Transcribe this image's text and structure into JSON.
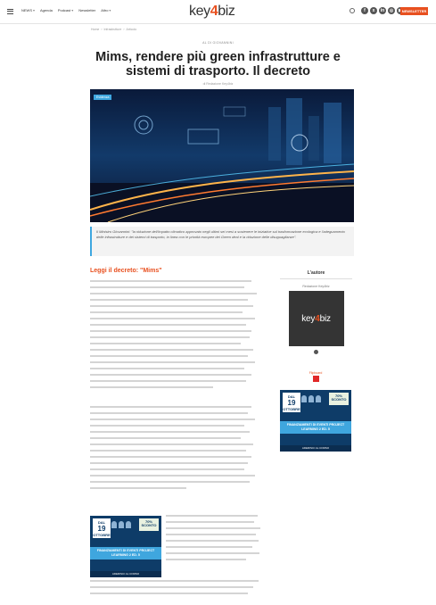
{
  "header": {
    "nav_items": [
      "NEWS",
      "Agenda",
      "Podcast",
      "Newsletter",
      "Altro"
    ],
    "logo_pre": "key",
    "logo_mark": "4",
    "logo_post": "biz",
    "newsletter_label": "NEWSLETTER",
    "social_icons": [
      "facebook-icon",
      "x-icon",
      "linkedin-icon",
      "instagram-icon",
      "youtube-icon"
    ],
    "brand_color": "#e8501f"
  },
  "breadcrumb": [
    "Home",
    "Infrastrutture",
    "Articolo"
  ],
  "article": {
    "category": "AL DI GIOVANNINI",
    "title": "Mims, rendere più green infrastrutture e sistemi di trasporto. Il decreto",
    "byline": "di Redazione Key4biz",
    "hero_tag": "Evidenza",
    "summary": "Il Ministro Giovannini: \"la riduzione dell'impatto climatico approvato negli ultimi sei mesi a sostenere le iniziative sul trasformazione ecologica e l'adeguamento delle infrastrutture e dei sistemi di trasporto, in linea con le priorità europee dei Green deal e la riduzione delle disuguaglianze\".",
    "section_heading": "Leggi il decreto: \"Mims\""
  },
  "banner": {
    "date_label": "DAL",
    "date_day": "19",
    "date_month": "OTTOBRE",
    "badge": "70% SCONTO",
    "band_text": "FINANZIAMENTI DI EVENTI PROJECT LEARNING 2 ED. 5",
    "footer": "ADERISCI AL CORSO"
  },
  "sidebar": {
    "author_heading": "L'autore",
    "author_name": "Redazione Key4biz",
    "flipboard_label": "Flipboard"
  }
}
